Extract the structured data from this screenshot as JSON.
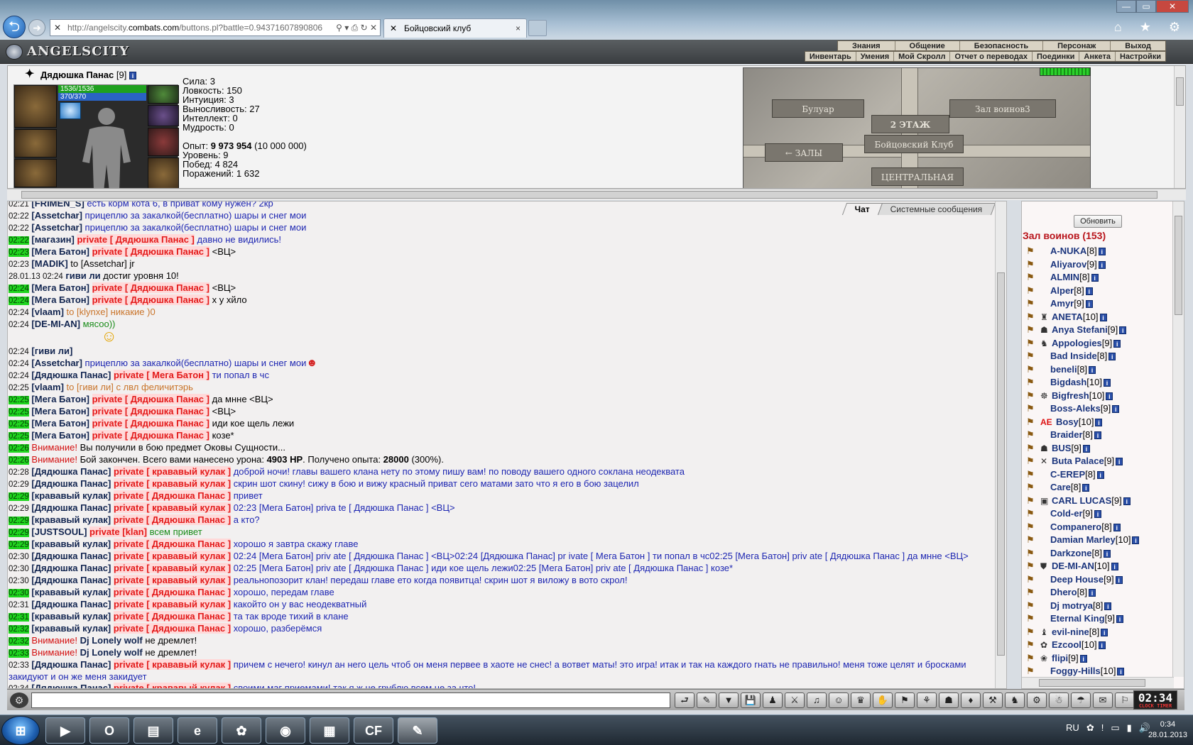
{
  "browser": {
    "url_prefix": "http://angelscity.",
    "url_domain": "combats.com",
    "url_rest": "/buttons.pl?battle=0.94371607890806",
    "tab_title": "Бойцовский клуб",
    "tab_close": "×",
    "back": "⮌",
    "forward": "➜",
    "win_controls": [
      "—",
      "▭",
      "✕"
    ],
    "toolbar_icons": "⌂ ★ ⚙",
    "url_tools": "⚲ ▾ ⎙ ↻ ✕"
  },
  "game": {
    "logo": "ANGELSCITY",
    "menu_top": [
      "Знания",
      "Общение",
      "Безопасность",
      "Персонаж",
      "Выход"
    ],
    "menu_bottom": [
      "Инвентарь",
      "Умения",
      "Мой Скролл",
      "Отчет о переводах",
      "Поединки",
      "Анкета",
      "Настройки"
    ]
  },
  "character": {
    "name": "Дядюшка Панас",
    "level": "[9]",
    "info": "i",
    "hp": "1536/1536",
    "mp": "370/370",
    "stats": {
      "strength": "Сила: 3",
      "agility": "Ловкость: 150",
      "intuition": "Интуиция: 3",
      "endurance": "Выносливость: 27",
      "intellect": "Интеллект: 0",
      "wisdom": "Мудрость: 0"
    },
    "exp_label": "Опыт: ",
    "exp_value": "9 973 954",
    "exp_next": " (10 000 000)",
    "level_line": "Уровень: 9",
    "wins": "Побед: 4 824",
    "losses": "Поражений: 1 632"
  },
  "map": {
    "boulevard": "Булуар",
    "warriors3": "Зал воинов3",
    "floor": "2 ЭТАЖ",
    "club": "Бойцовский Клуб",
    "halls": "← ЗАЛЫ",
    "central": "ЦЕНТРАЛЬНАЯ"
  },
  "chat": {
    "tabs": [
      "Чат",
      "Системные сообщения"
    ],
    "input_placeholder": "",
    "messages": [
      {
        "ts": "02:21",
        "nick": "[FRIMEN_S]",
        "text": " есть корм кота 6, в приват кому нужен? 2кр"
      },
      {
        "ts": "02:22",
        "nick": "[Assetchar]",
        "text": " прицеплю за закалкой(бесплатно) шары и снег мои"
      },
      {
        "ts": "02:22",
        "nick": "[Assetchar]",
        "text": " прицеплю за закалкой(бесплатно) шары и снег мои"
      },
      {
        "ts": "02:22",
        "hl": true,
        "nick": "[магазин]",
        "priv": "private [ Дядюшка Панас ]",
        "text": " давно не видились!"
      },
      {
        "ts": "02:23",
        "hl": true,
        "nick": "[Мега Батон]",
        "priv": "private [ Дядюшка Панас ]",
        "black": " <ВЦ>"
      },
      {
        "ts": "02:23",
        "nick": "[MADIK]",
        "black": " to [Assetchar] jr"
      },
      {
        "ts": "28.01.13 02:24",
        "nick": "гиви ли",
        "black": " достиг уровня 10!",
        "sys": true
      },
      {
        "ts": "02:24",
        "hl": true,
        "nick": "[Мега Батон]",
        "priv": "private [ Дядюшка Панас ]",
        "black": " <ВЦ>"
      },
      {
        "ts": "02:24",
        "hl": true,
        "nick": "[Мега Батон]",
        "priv": "private [ Дядюшка Панас ]",
        "black": " х у хйло"
      },
      {
        "ts": "02:24",
        "nick": "[vlaam]",
        "orange": " to [klynxe] никакие )0"
      },
      {
        "ts": "02:24",
        "nick": "[DE-MI-AN]",
        "green": " мясоо))"
      },
      {
        "ts": "02:24",
        "nick": "[гиви ли]",
        "emoji": true
      },
      {
        "ts": "02:24",
        "nick": "[Assetchar]",
        "text": " прицеплю за закалкой(бесплатно) шары и снег мои",
        "emoji2": true
      },
      {
        "ts": "02:24",
        "nick": "[Дядюшка Панас]",
        "priv": "private [ Мега Батон ]",
        "text": " ти попал в чс"
      },
      {
        "ts": "02:25",
        "nick": "[vlaam]",
        "orange": " to [гиви ли] с лвл феличитэрь"
      },
      {
        "ts": "02:25",
        "hl": true,
        "nick": "[Мега Батон]",
        "priv": "private [ Дядюшка Панас ]",
        "black": " да мнне <ВЦ>"
      },
      {
        "ts": "02:25",
        "hl": true,
        "nick": "[Мега Батон]",
        "priv": "private [ Дядюшка Панас ]",
        "black": " <ВЦ>"
      },
      {
        "ts": "02:25",
        "hl": true,
        "nick": "[Мега Батон]",
        "priv": "private [ Дядюшка Панас ]",
        "black": " иди кое щель лежи"
      },
      {
        "ts": "02:25",
        "hl": true,
        "nick": "[Мега Батон]",
        "priv": "private [ Дядюшка Панас ]",
        "black": " козе*"
      },
      {
        "ts": "02:26",
        "hl": true,
        "warn": "Внимание!",
        "black": " Вы получили в бою предмет Оковы Сущности..."
      },
      {
        "ts": "02:26",
        "hl": true,
        "warn": "Внимание!",
        "black": " Бой закончен. Всего вами нанесено урона: ",
        "bold1": "4903 HP",
        "black2": ". Получено опыта: ",
        "bold2": "28000",
        "black3": " (300%)."
      },
      {
        "ts": "02:28",
        "nick": "[Дядюшка Панас]",
        "priv": "private [ крававый кулак ]",
        "text": " доброй ночи! главы вашего клана нету по этому пишу вам! по поводу вашего одного соклана неодеквата"
      },
      {
        "ts": "02:29",
        "nick": "[Дядюшка Панас]",
        "priv": "private [ крававый кулак ]",
        "text": " скрин шот скину! сижу в бою и вижу красный приват сего матами зато что я его в бою зацелил"
      },
      {
        "ts": "02:29",
        "hl": true,
        "nick": "[крававый кулак]",
        "priv": "private [ Дядюшка Панас ]",
        "text": " привет"
      },
      {
        "ts": "02:29",
        "nick": "[Дядюшка Панас]",
        "priv": "private [ крававый кулак ]",
        "text": " 02:23 [Мега Батон] priva te [ Дядюшка Панас ] <ВЦ>"
      },
      {
        "ts": "02:29",
        "hl": true,
        "nick": "[крававый кулак]",
        "priv": "private [ Дядюшка Панас ]",
        "text": " а кто?"
      },
      {
        "ts": "02:29",
        "hl": true,
        "nick": "[JUSTSOUL]",
        "priv": "private [klan]",
        "green": " всем привет"
      },
      {
        "ts": "02:29",
        "hl": true,
        "nick": "[крававый кулак]",
        "priv": "private [ Дядюшка Панас ]",
        "text": " хорошо я завтра скажу главе"
      },
      {
        "ts": "02:30",
        "nick": "[Дядюшка Панас]",
        "priv": "private [ крававый кулак ]",
        "text": " 02:24 [Мега Батон] priv ate [ Дядюшка Панас ] <ВЦ>02:24 [Дядюшка Панас] pr ivate [ Мега Батон ] ти попал в чс02:25 [Мега Батон] priv ate [ Дядюшка Панас ] да мнне <ВЦ>",
        "wrap": true
      },
      {
        "ts": "02:30",
        "nick": "[Дядюшка Панас]",
        "priv": "private [ крававый кулак ]",
        "text": " 02:25 [Мега Батон] priv ate [ Дядюшка Панас ] иди кое щель лежи02:25 [Мега Батон] priv ate [ Дядюшка Панас ] козе*"
      },
      {
        "ts": "02:30",
        "nick": "[Дядюшка Панас]",
        "priv": "private [ крававый кулак ]",
        "text": " реальнопозорит клан! передаш главе ето когда появитца! скрин шот я виложу в вото скрол!"
      },
      {
        "ts": "02:30",
        "hl": true,
        "nick": "[крававый кулак]",
        "priv": "private [ Дядюшка Панас ]",
        "text": " хорошо, передам главе"
      },
      {
        "ts": "02:31",
        "nick": "[Дядюшка Панас]",
        "priv": "private [ крававый кулак ]",
        "text": " какойто он у вас неодекватный"
      },
      {
        "ts": "02:31",
        "hl": true,
        "nick": "[крававый кулак]",
        "priv": "private [ Дядюшка Панас ]",
        "text": " та так вроде тихий в клане"
      },
      {
        "ts": "02:32",
        "hl": true,
        "nick": "[крававый кулак]",
        "priv": "private [ Дядюшка Панас ]",
        "text": " хорошо, разберёмся"
      },
      {
        "ts": "02:32",
        "hl": true,
        "warn": "Внимание!",
        "nick2": " Dj Lonely wolf",
        "black": " не дремлет!"
      },
      {
        "ts": "02:33",
        "hl": true,
        "warn": "Внимание!",
        "nick2": " Dj Lonely wolf",
        "black": " не дремлет!"
      },
      {
        "ts": "02:33",
        "nick": "[Дядюшка Панас]",
        "priv": "private [ крававый кулак ]",
        "text": " причем с нечего! кинул ан него цель чтоб он меня первее в хаоте не снес! а вответ маты! это игра! итак и так на каждого гнать не правильно! меня тоже целят и бросками закидуют и он же меня закидует",
        "wrap": true
      },
      {
        "ts": "02:34",
        "nick": "[Дядюшка Панас]",
        "priv": "private [ крававый кулак ]",
        "text": " своими маг приемами! так я ж не грублю всем не за что!"
      }
    ]
  },
  "hall": {
    "refresh": "Обновить",
    "title": "Зал воинов (153)",
    "warriors": [
      {
        "name": "A-NUKA",
        "lvl": "[8]"
      },
      {
        "name": "Aliyarov",
        "lvl": "[9]"
      },
      {
        "name": "ALMIN",
        "lvl": "[8]"
      },
      {
        "name": "Alper",
        "lvl": "[8]"
      },
      {
        "name": "Amyr",
        "lvl": "[9]"
      },
      {
        "name": "ANETA",
        "lvl": "[10]",
        "badge": "♜"
      },
      {
        "name": "Anya Stefani",
        "lvl": "[9]",
        "badge": "☗"
      },
      {
        "name": "Appologies",
        "lvl": "[9]",
        "badge": "♞"
      },
      {
        "name": "Bad Inside",
        "lvl": "[8]"
      },
      {
        "name": "beneli",
        "lvl": "[8]"
      },
      {
        "name": "Bigdash",
        "lvl": "[10]"
      },
      {
        "name": "Bigfresh",
        "lvl": "[10]",
        "badge": "☸"
      },
      {
        "name": "Boss-Aleks",
        "lvl": "[9]"
      },
      {
        "name": "Bosy",
        "lvl": "[10]",
        "badge": "AE"
      },
      {
        "name": "Braider",
        "lvl": "[8]"
      },
      {
        "name": "BUS",
        "lvl": "[9]",
        "badge": "☗"
      },
      {
        "name": "Buta Palace",
        "lvl": "[9]",
        "badge": "✕"
      },
      {
        "name": "C-EREP",
        "lvl": "[8]"
      },
      {
        "name": "Care",
        "lvl": "[8]"
      },
      {
        "name": "CARL LUCAS",
        "lvl": "[9]",
        "badge": "▣"
      },
      {
        "name": "Cold-er",
        "lvl": "[9]"
      },
      {
        "name": "Companero",
        "lvl": "[8]"
      },
      {
        "name": "Damian Marley",
        "lvl": "[10]"
      },
      {
        "name": "Darkzone",
        "lvl": "[8]"
      },
      {
        "name": "DE-MI-AN",
        "lvl": "[10]",
        "badge": "⛊"
      },
      {
        "name": "Deep House",
        "lvl": "[9]"
      },
      {
        "name": "Dhero",
        "lvl": "[8]"
      },
      {
        "name": "Dj motrya",
        "lvl": "[8]"
      },
      {
        "name": "Eternal King",
        "lvl": "[9]"
      },
      {
        "name": "evil-nine",
        "lvl": "[8]",
        "badge": "♝"
      },
      {
        "name": "Ezcool",
        "lvl": "[10]",
        "badge": "✿"
      },
      {
        "name": "flipi",
        "lvl": "[9]",
        "badge": "❀"
      },
      {
        "name": "Foggy-Hills",
        "lvl": "[10]"
      }
    ]
  },
  "inputbar": {
    "gear": "⚙",
    "icons": [
      "⮐",
      "✎",
      "▼",
      "💾",
      "♟",
      "⚔",
      "♫",
      "☺",
      "♛",
      "✋",
      "⚑",
      "⚘",
      "☗",
      "♦",
      "⚒",
      "♞",
      "⚙",
      "☃",
      "☂",
      "✉",
      "⚐"
    ],
    "clock": "02:34",
    "clock_caption": "CLOCK TIMER"
  },
  "taskbar": {
    "start": "⊞",
    "apps": [
      "▶",
      "O",
      "▤",
      "e",
      "✿",
      "◉",
      "▦",
      "CF",
      "✎"
    ],
    "lang": "RU",
    "tray": [
      "✿",
      "!",
      "▭",
      "▮",
      "🔊"
    ],
    "time": "0:34",
    "date": "28.01.2013"
  }
}
